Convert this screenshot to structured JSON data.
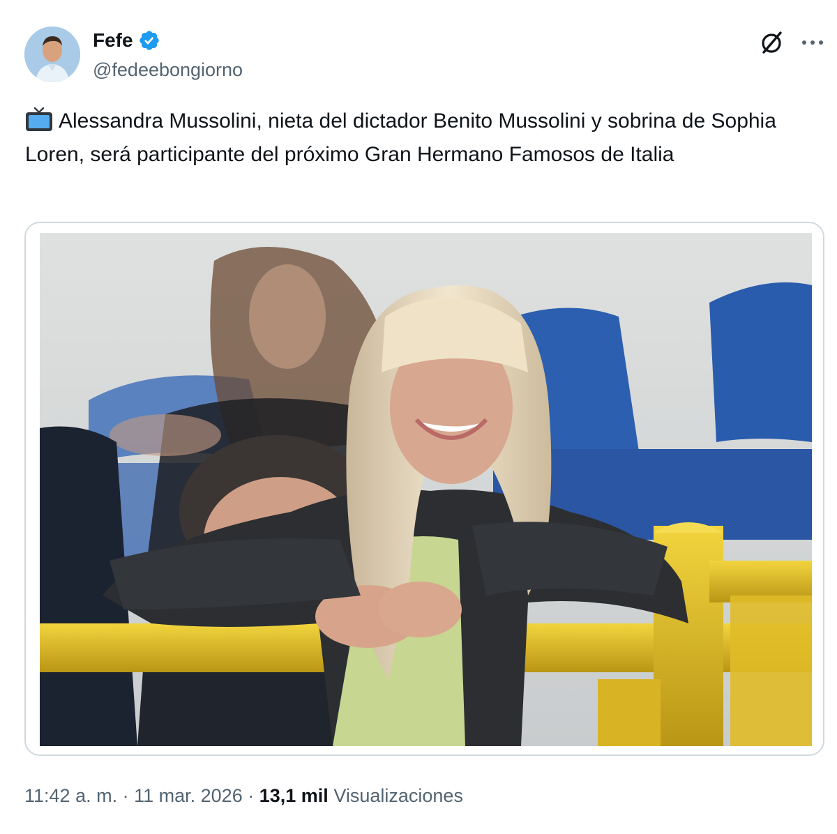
{
  "author": {
    "display_name": "Fefe",
    "handle": "@fedeebongiorno",
    "verified": true,
    "avatar_icon": "person-avatar"
  },
  "actions": {
    "grok_icon": "grok-icon",
    "more_icon": "more-options-icon"
  },
  "tweet": {
    "emoji_icon": "television-icon",
    "text": "Alessandra Mussolini, nieta del dictador Benito Mussolini y sobrina de Sophia Loren, será participante del próximo Gran Hermano Famosos de Italia"
  },
  "media": {
    "type": "photo",
    "icon": "photo-of-blonde-woman-in-stadium"
  },
  "meta": {
    "time": "11:42 a. m.",
    "separator": "·",
    "date": "11 mar. 2026",
    "views_count": "13,1 mil",
    "views_label": "Visualizaciones"
  },
  "colors": {
    "text_primary": "#0f1419",
    "text_secondary": "#536471",
    "verified_blue": "#1d9bf0",
    "border": "#cfd9de"
  }
}
